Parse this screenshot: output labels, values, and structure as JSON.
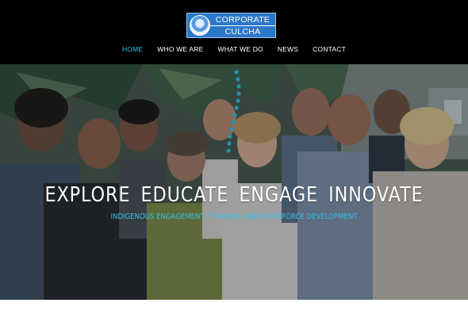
{
  "logo": {
    "line1": "CORPORATE",
    "line2": "CULCHA"
  },
  "nav": {
    "items": [
      {
        "label": "HOME",
        "active": true
      },
      {
        "label": "WHO WE ARE",
        "active": false
      },
      {
        "label": "WHAT WE DO",
        "active": false
      },
      {
        "label": "NEWS",
        "active": false
      },
      {
        "label": "CONTACT",
        "active": false
      }
    ]
  },
  "hero": {
    "headline": "EXPLORE  EDUCATE  ENGAGE  INNOVATE",
    "subline": "INDIGENOUS ENGAGEMENT, TRAINING AND WORKFORCE DEVELOPMENT"
  },
  "colors": {
    "accent": "#35c0e6",
    "topbar": "#000000",
    "logo_blue": "#2b78c9"
  }
}
